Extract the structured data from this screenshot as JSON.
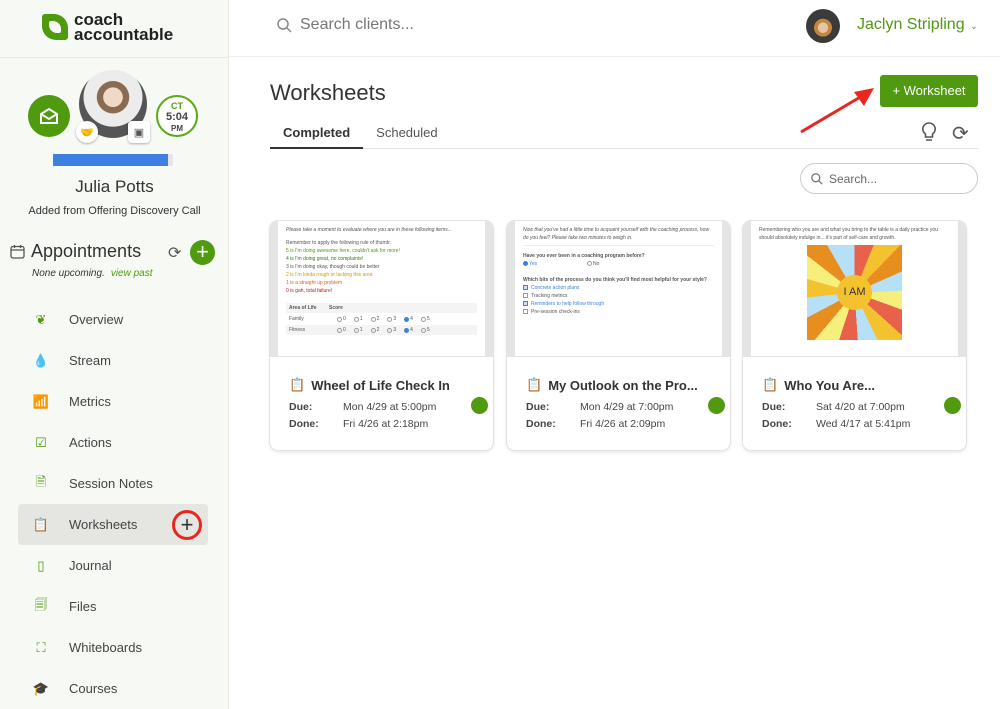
{
  "brand": {
    "line1": "coach",
    "line2": "accountable",
    "accent": "#4f9a0f"
  },
  "client": {
    "name": "Julia Potts",
    "source": "Added from Offering Discovery Call",
    "clock": {
      "tz": "CT",
      "time": "5:04",
      "ampm": "PM"
    },
    "progress_percent": 96
  },
  "appointments": {
    "title": "Appointments",
    "status": "None upcoming.",
    "view_past": "view past"
  },
  "nav": [
    {
      "label": "Overview",
      "icon": "leaf-icon"
    },
    {
      "label": "Stream",
      "icon": "drop-icon"
    },
    {
      "label": "Metrics",
      "icon": "metrics-icon"
    },
    {
      "label": "Actions",
      "icon": "check-square-icon"
    },
    {
      "label": "Session Notes",
      "icon": "notes-icon"
    },
    {
      "label": "Worksheets",
      "icon": "clipboard-icon",
      "active": true
    },
    {
      "label": "Journal",
      "icon": "journal-icon"
    },
    {
      "label": "Files",
      "icon": "files-icon"
    },
    {
      "label": "Whiteboards",
      "icon": "whiteboard-icon"
    },
    {
      "label": "Courses",
      "icon": "graduation-cap-icon"
    }
  ],
  "header": {
    "search_placeholder": "Search clients...",
    "user_name": "Jaclyn Stripling"
  },
  "main": {
    "title": "Worksheets",
    "add_button": "+ Worksheet",
    "tabs": [
      {
        "label": "Completed",
        "active": true
      },
      {
        "label": "Scheduled"
      }
    ],
    "search_placeholder": "Search..."
  },
  "cards": [
    {
      "title": "Wheel of Life Check In",
      "due_label": "Due:",
      "due": "Mon 4/29 at 5:00pm",
      "done_label": "Done:",
      "done": "Fri 4/26 at 2:18pm",
      "preview": {
        "intro": "Please take a moment to evaluate where you are in these following items...",
        "rule": "Remember to apply the following rule of thumb:",
        "scale": [
          "5 is I'm doing awesome here, couldn't ask for more!",
          "4 is I'm doing great, no complaints!",
          "3 is I'm doing okay, though could be better",
          "2 is I'm kinda rough or lacking this area",
          "1 is a straight up problem",
          "0 is gah, total failure!"
        ],
        "table_headers": [
          "Area of Life",
          "Score"
        ],
        "rows": [
          "Family",
          "Fitness"
        ]
      }
    },
    {
      "title": "My Outlook on the Pro...",
      "due_label": "Due:",
      "due": "Mon 4/29 at 7:00pm",
      "done_label": "Done:",
      "done": "Fri 4/26 at 2:09pm",
      "preview": {
        "intro": "Now that you've had a little time to acquaint yourself with the coaching process, how do you feel? Please take two minutes to weigh in.",
        "q1": "Have you ever been in a coaching program before?",
        "yes": "Yes",
        "no": "No",
        "q2": "Which bits of the process do you think you'll find most helpful for your style?",
        "options": [
          "Concrete action plans",
          "Tracking metrics",
          "Reminders to help follow through",
          "Pre-session check-ins"
        ]
      }
    },
    {
      "title": "Who You Are...",
      "due_label": "Due:",
      "due": "Sat 4/20 at 7:00pm",
      "done_label": "Done:",
      "done": "Wed 4/17 at 5:41pm",
      "preview": {
        "intro": "Remembering who you are and what you bring to the table is a daily practice you should absolutely indulge in... it's part of self-care and growth.",
        "center": "I AM"
      }
    }
  ]
}
